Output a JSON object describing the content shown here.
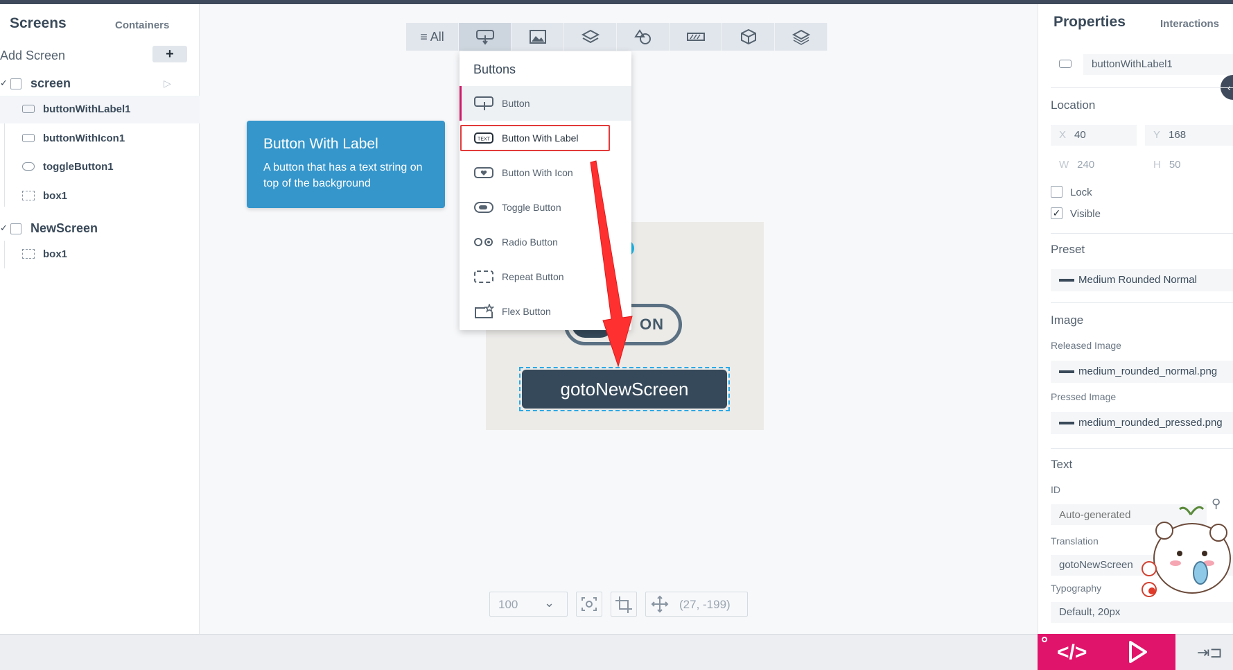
{
  "left_panel": {
    "tab_active": "Screens",
    "tab_other": "Containers",
    "add_screen_label": "Add Screen",
    "add_button": "+",
    "screens": [
      {
        "name": "screen",
        "items": [
          "buttonWithLabel1",
          "buttonWithIcon1",
          "toggleButton1",
          "box1"
        ]
      },
      {
        "name": "NewScreen",
        "items": [
          "box1"
        ]
      }
    ]
  },
  "toolbar": {
    "all_label": "≡ All",
    "icons": [
      "buttons-icon",
      "image-icon",
      "containers-icon",
      "shapes-icon",
      "progress-icon",
      "3d-icon",
      "layers-icon"
    ]
  },
  "tooltip": {
    "title": "Button With Label",
    "description": "A button that has a text string on top of the background"
  },
  "dropdown": {
    "title": "Buttons",
    "items": [
      "Button",
      "Button With Label",
      "Button With Icon",
      "Toggle Button",
      "Radio Button",
      "Repeat Button",
      "Flex Button"
    ]
  },
  "preview": {
    "toggle_text": "ON",
    "goto_label": "gotoNewScreen"
  },
  "zoom_bar": {
    "zoom_value": "100",
    "coordinates": "(27, -199)"
  },
  "right_panel": {
    "tab_active": "Properties",
    "tab_other": "Interactions",
    "element_name": "buttonWithLabel1",
    "location_title": "Location",
    "x_label": "X",
    "x_value": "40",
    "y_label": "Y",
    "y_value": "168",
    "w_label": "W",
    "w_value": "240",
    "h_label": "H",
    "h_value": "50",
    "lock_label": "Lock",
    "visible_label": "Visible",
    "preset_title": "Preset",
    "preset_value": "Medium Rounded Normal",
    "image_title": "Image",
    "released_label": "Released Image",
    "released_value": "medium_rounded_normal.png",
    "pressed_label": "Pressed Image",
    "pressed_value": "medium_rounded_pressed.png",
    "text_title": "Text",
    "id_label": "ID",
    "id_placeholder": "Auto-generated",
    "translation_label": "Translation",
    "translation_value": "gotoNewScreen",
    "typography_label": "Typography",
    "typography_value": "Default, 20px"
  },
  "bottom_bar": {
    "code_label": "</>"
  },
  "colors": {
    "accent_pink": "#e0146a",
    "tooltip_blue": "#3596cb",
    "highlight_red": "#e23a3a",
    "button_dark": "#35495a"
  }
}
